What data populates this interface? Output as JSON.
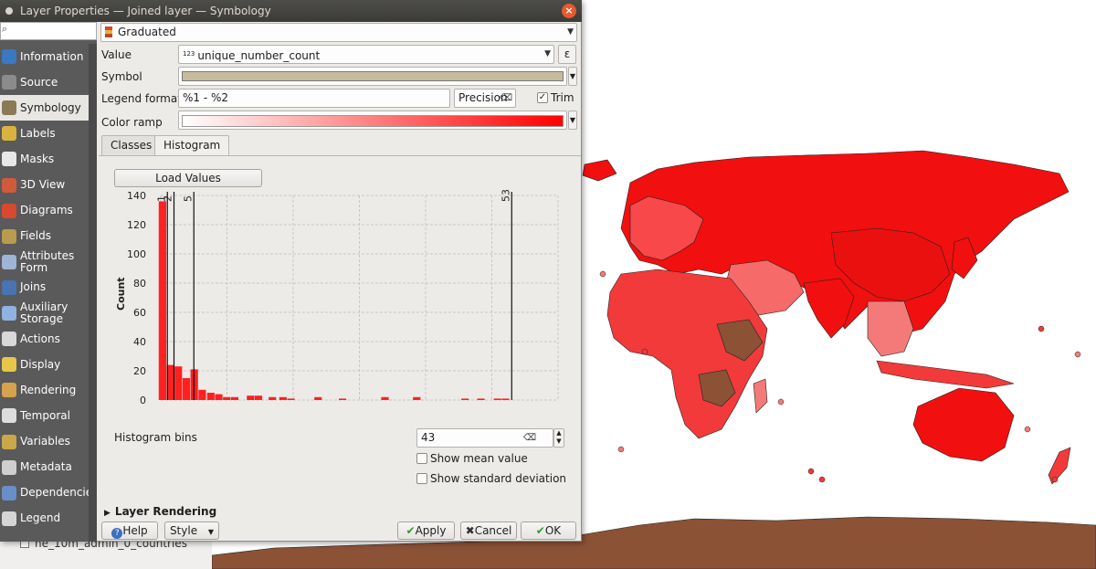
{
  "window": {
    "title": "Layer Properties — Joined layer — Symbology",
    "close_glyph": "×"
  },
  "sidebar": {
    "search_placeholder": "",
    "items": [
      {
        "label": "Information",
        "icon": "information-icon",
        "color": "#3a78c2"
      },
      {
        "label": "Source",
        "icon": "source-icon",
        "color": "#8b8b8b"
      },
      {
        "label": "Symbology",
        "icon": "symbology-icon",
        "color": "#8a7a55",
        "active": true
      },
      {
        "label": "Labels",
        "icon": "labels-icon",
        "color": "#d9b340"
      },
      {
        "label": "Masks",
        "icon": "masks-icon",
        "color": "#e8e8e8"
      },
      {
        "label": "3D View",
        "icon": "3d-view-icon",
        "color": "#d05a3a"
      },
      {
        "label": "Diagrams",
        "icon": "diagrams-icon",
        "color": "#d8492f"
      },
      {
        "label": "Fields",
        "icon": "fields-icon",
        "color": "#b89b4c"
      },
      {
        "label": "Attributes Form",
        "icon": "attributes-form-icon",
        "color": "#9fb5d6"
      },
      {
        "label": "Joins",
        "icon": "joins-icon",
        "color": "#4a73b5"
      },
      {
        "label": "Auxiliary Storage",
        "icon": "auxiliary-storage-icon",
        "color": "#8fb3e0"
      },
      {
        "label": "Actions",
        "icon": "actions-icon",
        "color": "#d8d8d8"
      },
      {
        "label": "Display",
        "icon": "display-icon",
        "color": "#e8c64a"
      },
      {
        "label": "Rendering",
        "icon": "rendering-icon",
        "color": "#d6a24c"
      },
      {
        "label": "Temporal",
        "icon": "temporal-icon",
        "color": "#dddddd"
      },
      {
        "label": "Variables",
        "icon": "variables-icon",
        "color": "#c9a84a"
      },
      {
        "label": "Metadata",
        "icon": "metadata-icon",
        "color": "#cfcfcf"
      },
      {
        "label": "Dependencies",
        "icon": "dependencies-icon",
        "color": "#6a8ec7"
      },
      {
        "label": "Legend",
        "icon": "legend-icon",
        "color": "#d5d5d5"
      }
    ]
  },
  "symbology": {
    "renderer": "Graduated",
    "value_label": "Value",
    "value_field_type": "123",
    "value_field": "unique_number_count",
    "expression_glyph": "ε",
    "symbol_label": "Symbol",
    "legend_format_label": "Legend format",
    "legend_format": "%1 - %2",
    "precision_label": "Precision",
    "trim_label": "Trim",
    "trim_checked": true,
    "color_ramp_label": "Color ramp",
    "tabs": [
      "Classes",
      "Histogram"
    ],
    "active_tab": "Histogram",
    "symbol_color": "#c7bb9b",
    "ramp_start": "#ffffff",
    "ramp_end": "#ff0000"
  },
  "histogram": {
    "load_values_label": "Load Values",
    "bins_label": "Histogram bins",
    "bins_value": "43",
    "show_mean_label": "Show mean value",
    "show_mean_checked": false,
    "show_stddev_label": "Show standard deviation",
    "show_stddev_checked": false
  },
  "footer": {
    "layer_rendering_label": "Layer Rendering",
    "help_label": "Help",
    "style_label": "Style",
    "apply_label": "Apply",
    "cancel_label": "Cancel",
    "ok_label": "OK"
  },
  "background": {
    "layer_list_item": "ne_10m_admin_0_countries"
  },
  "chart_data": {
    "type": "bar",
    "title": "",
    "xlabel": "",
    "ylabel": "Count",
    "xlim": [
      0,
      60
    ],
    "ylim": [
      0,
      140
    ],
    "x_ticks": [
      0,
      10,
      20,
      30,
      40,
      50,
      60
    ],
    "y_ticks": [
      0,
      20,
      40,
      60,
      80,
      100,
      120,
      140
    ],
    "grid": true,
    "bin_width": 1.21,
    "bins": [
      {
        "x": 0.3,
        "count": 136
      },
      {
        "x": 1.5,
        "count": 24
      },
      {
        "x": 2.7,
        "count": 23
      },
      {
        "x": 3.9,
        "count": 15
      },
      {
        "x": 5.1,
        "count": 21
      },
      {
        "x": 6.3,
        "count": 7
      },
      {
        "x": 7.6,
        "count": 5
      },
      {
        "x": 8.8,
        "count": 4
      },
      {
        "x": 10.0,
        "count": 2
      },
      {
        "x": 11.2,
        "count": 2
      },
      {
        "x": 13.6,
        "count": 3
      },
      {
        "x": 14.8,
        "count": 3
      },
      {
        "x": 16.9,
        "count": 2
      },
      {
        "x": 18.5,
        "count": 2
      },
      {
        "x": 19.7,
        "count": 1
      },
      {
        "x": 23.8,
        "count": 2
      },
      {
        "x": 27.5,
        "count": 1
      },
      {
        "x": 33.9,
        "count": 2
      },
      {
        "x": 38.7,
        "count": 2
      },
      {
        "x": 46.0,
        "count": 1
      },
      {
        "x": 48.4,
        "count": 1
      },
      {
        "x": 50.9,
        "count": 1
      },
      {
        "x": 52.1,
        "count": 1
      }
    ],
    "class_breaks": [
      {
        "value": 1,
        "label": "1"
      },
      {
        "value": 2,
        "label": "2"
      },
      {
        "value": 5,
        "label": "5"
      },
      {
        "value": 53,
        "label": "53"
      }
    ],
    "bar_color": "#ff2020"
  }
}
